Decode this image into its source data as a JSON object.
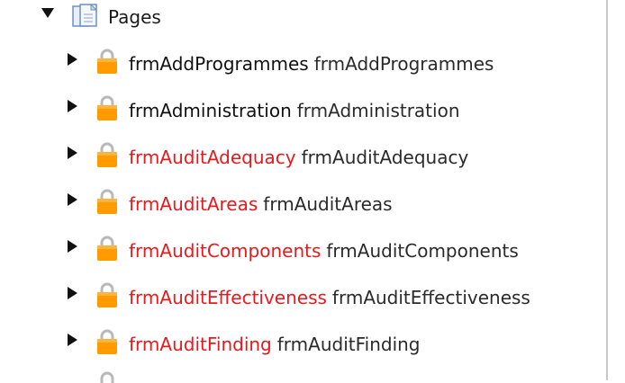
{
  "tree": {
    "root": {
      "label": "Pages",
      "icon": "pages-icon",
      "expanded": true
    },
    "items": [
      {
        "name": "frmAddProgrammes",
        "caption": "frmAddProgrammes",
        "color": "#111111",
        "icon": "lock-icon"
      },
      {
        "name": "frmAdministration",
        "caption": "frmAdministration",
        "color": "#111111",
        "icon": "lock-icon"
      },
      {
        "name": "frmAuditAdequacy",
        "caption": "frmAuditAdequacy",
        "color": "#e8191c",
        "icon": "lock-icon"
      },
      {
        "name": "frmAuditAreas",
        "caption": "frmAuditAreas",
        "color": "#e8191c",
        "icon": "lock-icon"
      },
      {
        "name": "frmAuditComponents",
        "caption": "frmAuditComponents",
        "color": "#e8191c",
        "icon": "lock-icon"
      },
      {
        "name": "frmAuditEffectiveness",
        "caption": "frmAuditEffectiveness",
        "color": "#e8191c",
        "icon": "lock-icon"
      },
      {
        "name": "frmAuditFinding",
        "caption": "frmAuditFinding",
        "color": "#e8191c",
        "icon": "lock-icon"
      }
    ]
  }
}
